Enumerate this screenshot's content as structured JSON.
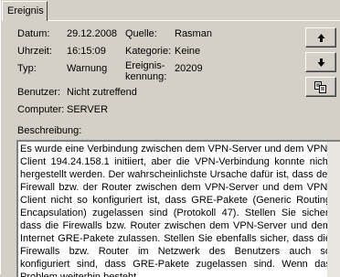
{
  "tab": {
    "label": "Ereignis"
  },
  "fields": {
    "datum": {
      "label": "Datum:",
      "value": "29.12.2008"
    },
    "uhrzeit": {
      "label": "Uhrzeit:",
      "value": "16:15:09"
    },
    "typ": {
      "label": "Typ:",
      "value": "Warnung"
    },
    "quelle": {
      "label": "Quelle:",
      "value": "Rasman"
    },
    "kategorie": {
      "label": "Kategorie:",
      "value": "Keine"
    },
    "kennung": {
      "label_line1": "Ereignis-",
      "label_line2": "kennung:",
      "value": "20209"
    },
    "benutzer": {
      "label": "Benutzer:",
      "value": "Nicht zutreffend"
    },
    "computer": {
      "label": "Computer:",
      "value": "SERVER"
    }
  },
  "description": {
    "label": "Beschreibung:",
    "text": "Es wurde eine Verbindung zwischen dem VPN-Server und dem VPN-Client 194.24.158.1 initiiert, aber die VPN-Verbindung konnte nicht hergestellt werden. Der wahrscheinlichste Ursache dafür ist, dass der Firewall bzw. der Router zwischen dem VPN-Server und dem VPN-Client nicht so konfiguriert ist, dass GRE-Pakete (Generic Routing Encapsulation) zugelassen sind (Protokoll 47). Stellen Sie sicher, dass die Firewalls bzw. Router zwischen dem VPN-Server und dem Internet GRE-Pakete zulassen. Stellen Sie ebenfalls sicher, dass die Firewalls bzw. Router im Netzwerk des Benutzers auch so konfiguriert sind, dass GRE-Pakete zugelassen sind. Wenn das Problem weiterhin besteht,"
  },
  "buttons": {
    "up_icon": "arrow-up-icon",
    "down_icon": "arrow-down-icon",
    "copy_icon": "copy-icon"
  }
}
